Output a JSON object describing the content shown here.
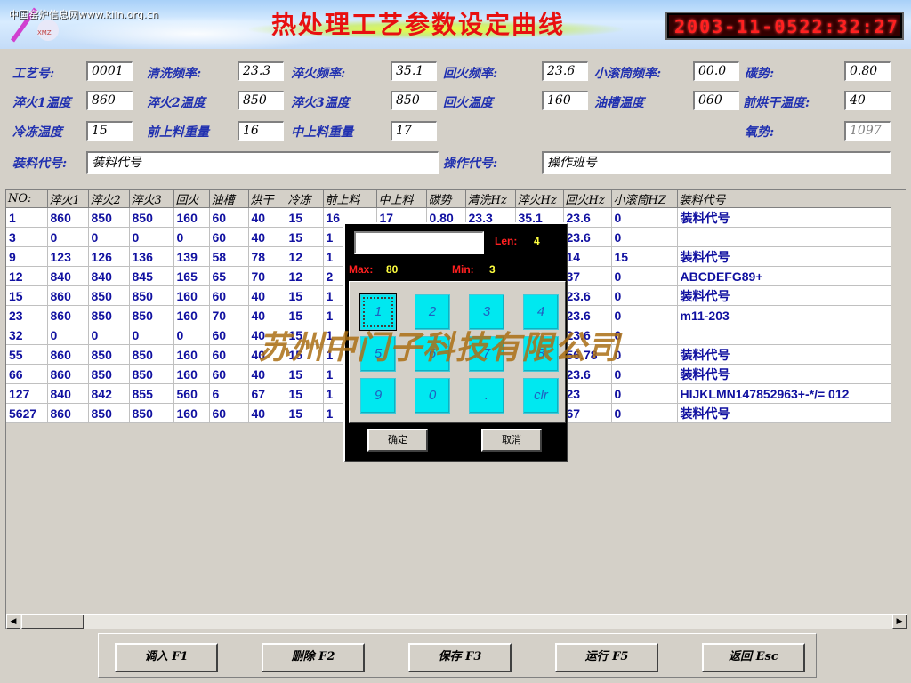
{
  "header": {
    "site_text": "中国窑炉信息网www.kiln.org.cn",
    "title": "热处理工艺参数设定曲线",
    "clock": "2003-11-0522:32:27"
  },
  "params": {
    "craft_no": {
      "label": "工艺号:",
      "value": "0001"
    },
    "clean_freq": {
      "label": "清洗频率:",
      "value": "23.3"
    },
    "quench_freq": {
      "label": "淬火频率:",
      "value": "35.1"
    },
    "temper_freq": {
      "label": "回火频率:",
      "value": "23.6"
    },
    "drum_freq": {
      "label": "小滚筒频率:",
      "value": "00.0"
    },
    "carbon": {
      "label": "碳势:",
      "value": "0.80"
    },
    "quench1_temp": {
      "label": "淬火1温度",
      "value": "860"
    },
    "quench2_temp": {
      "label": "淬火2温度",
      "value": "850"
    },
    "quench3_temp": {
      "label": "淬火3温度",
      "value": "850"
    },
    "temper_temp": {
      "label": "回火温度",
      "value": "160"
    },
    "oil_temp": {
      "label": "油槽温度",
      "value": "060"
    },
    "predry_temp": {
      "label": "前烘干温度:",
      "value": "40"
    },
    "freeze_temp": {
      "label": "冷冻温度",
      "value": "15"
    },
    "front_load": {
      "label": "前上料重量",
      "value": "16"
    },
    "mid_load": {
      "label": "中上料重量",
      "value": "17"
    },
    "oxygen": {
      "label": "氧势:",
      "value": "1097"
    },
    "material_code": {
      "label": "装料代号:",
      "value": "装料代号"
    },
    "operator_code": {
      "label": "操作代号:",
      "value": "操作班号"
    }
  },
  "table": {
    "columns": [
      "NO:",
      "淬火1",
      "淬火2",
      "淬火3",
      "回火",
      "油槽",
      "烘干",
      "冷冻",
      "前上料",
      "中上料",
      "碳势",
      "清洗Hz",
      "淬火Hz",
      "回火Hz",
      "小滚筒HZ",
      "装料代号"
    ],
    "rows": [
      [
        "1",
        "860",
        "850",
        "850",
        "160",
        "60",
        "40",
        "15",
        "16",
        "17",
        "0.80",
        "23.3",
        "35.1",
        "23.6",
        "0",
        "装料代号"
      ],
      [
        "3",
        "0",
        "0",
        "0",
        "0",
        "60",
        "40",
        "15",
        "1",
        "",
        "",
        "",
        "",
        "23.6",
        "0",
        ""
      ],
      [
        "9",
        "123",
        "126",
        "136",
        "139",
        "58",
        "78",
        "12",
        "1",
        "",
        "",
        "",
        "",
        "14",
        "15",
        "装料代号"
      ],
      [
        "12",
        "840",
        "840",
        "845",
        "165",
        "65",
        "70",
        "12",
        "2",
        "",
        "",
        "",
        "",
        "37",
        "0",
        "ABCDEFG89+"
      ],
      [
        "15",
        "860",
        "850",
        "850",
        "160",
        "60",
        "40",
        "15",
        "1",
        "",
        "",
        "",
        "",
        "23.6",
        "0",
        "装料代号"
      ],
      [
        "23",
        "860",
        "850",
        "850",
        "160",
        "70",
        "40",
        "15",
        "1",
        "",
        "",
        "",
        "",
        "23.6",
        "0",
        "m11-203"
      ],
      [
        "32",
        "0",
        "0",
        "0",
        "0",
        "60",
        "40",
        "15",
        "1",
        "",
        "",
        "",
        "",
        "23.6",
        "0",
        ""
      ],
      [
        "55",
        "860",
        "850",
        "850",
        "160",
        "60",
        "40",
        "15",
        "1",
        "",
        "",
        "",
        "",
        "56.78",
        "0",
        "装料代号"
      ],
      [
        "66",
        "860",
        "850",
        "850",
        "160",
        "60",
        "40",
        "15",
        "1",
        "",
        "",
        "",
        "",
        "23.6",
        "0",
        "装料代号"
      ],
      [
        "127",
        "840",
        "842",
        "855",
        "560",
        "6",
        "67",
        "15",
        "1",
        "",
        "",
        "",
        "",
        "23",
        "0",
        "HIJKLMN147852963+-*/= 012"
      ],
      [
        "5627",
        "860",
        "850",
        "850",
        "160",
        "60",
        "40",
        "15",
        "1",
        "",
        "",
        "",
        "",
        "67",
        "0",
        "装料代号"
      ]
    ]
  },
  "watermark": "苏州中门子科技有限公司",
  "keypad": {
    "input_value": "",
    "len_label": "Len:",
    "len_value": "4",
    "max_label": "Max:",
    "max_value": "80",
    "min_label": "Min:",
    "min_value": "3",
    "keys": [
      "1",
      "2",
      "3",
      "4",
      "5",
      "6",
      "7",
      "8",
      "9",
      "0",
      ".",
      "clr"
    ],
    "ok_label": "确定",
    "cancel_label": "取消"
  },
  "footer": {
    "load": "调入 F1",
    "delete": "删除 F2",
    "save": "保存 F3",
    "run": "运行 F5",
    "back": "返回 Esc"
  },
  "colors": {
    "title": "#e81010",
    "label": "#2030b0",
    "cell_text": "#1010a0",
    "key_face": "#00e8f0",
    "clock_digits": "#ff2020",
    "watermark": "#aa6e14"
  }
}
